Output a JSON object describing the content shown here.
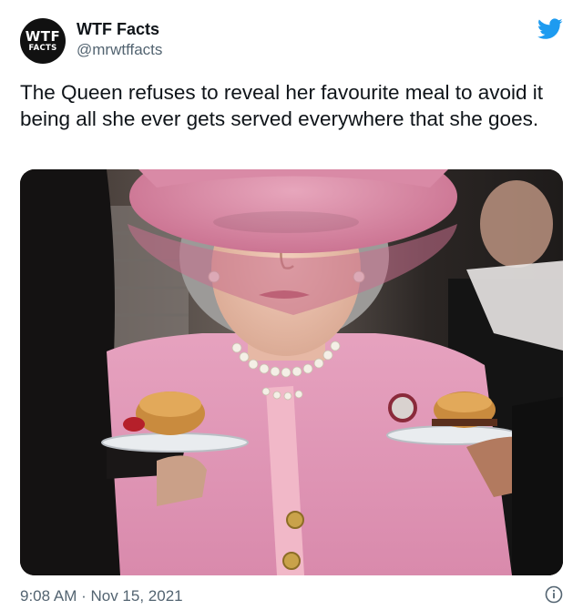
{
  "account": {
    "avatar_line1": "WTF",
    "avatar_line2": "FACTS",
    "display_name": "WTF Facts",
    "handle": "@mrwtffacts"
  },
  "tweet": {
    "text": "The Queen refuses to reveal her favourite meal to avoid it being all she ever gets served everywhere that she goes.",
    "timestamp": "9:08 AM · Nov 15, 2021"
  },
  "icons": {
    "brand": "twitter-bird-icon",
    "info": "info-icon"
  },
  "colors": {
    "twitter_blue": "#1d9bf0",
    "text_primary": "#0f1419",
    "text_secondary": "#536471"
  }
}
